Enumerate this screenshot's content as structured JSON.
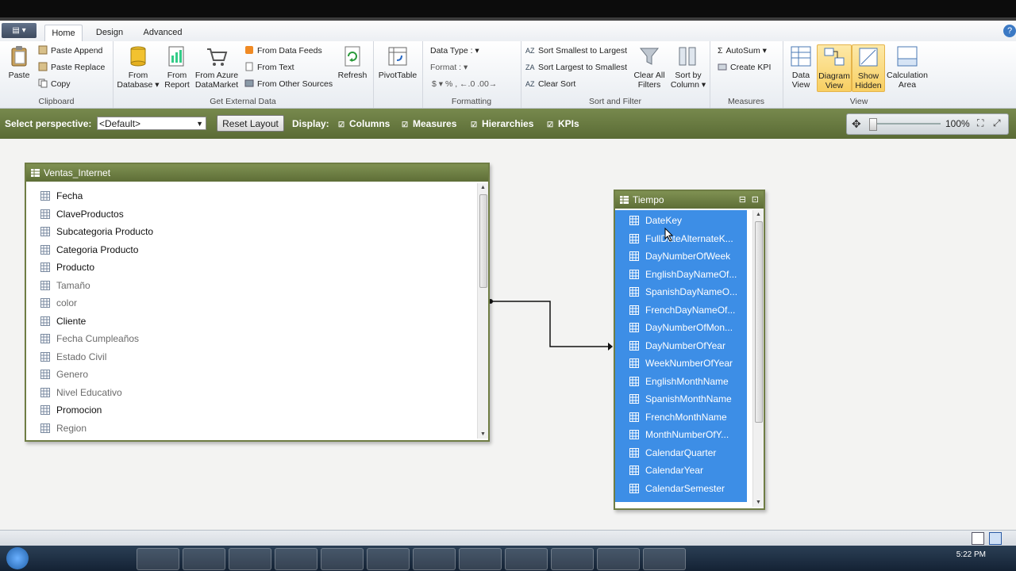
{
  "tabs": {
    "file": "▤ ▾",
    "home": "Home",
    "design": "Design",
    "advanced": "Advanced",
    "help": "?"
  },
  "ribbon": {
    "clipboard": {
      "label": "Clipboard",
      "paste": "Paste",
      "paste_append": "Paste Append",
      "paste_replace": "Paste Replace",
      "copy": "Copy"
    },
    "external": {
      "label": "Get External Data",
      "from_database": "From Database ▾",
      "from_report": "From Report",
      "from_azure": "From Azure DataMarket",
      "from_data_feeds": "From Data Feeds",
      "from_text": "From Text",
      "from_other": "From Other Sources",
      "refresh": "Refresh"
    },
    "pivot": {
      "label": "PivotTable"
    },
    "formatting": {
      "label": "Formatting",
      "data_type": "Data Type :",
      "format": "Format :",
      "symbols": "$ ▾ %  ,  ←.0 .00→"
    },
    "sort": {
      "label": "Sort and Filter",
      "asc": "Sort Smallest to Largest",
      "desc": "Sort Largest to Smallest",
      "clear": "Clear Sort",
      "clear_filters": "Clear All Filters",
      "sort_by_column": "Sort by Column ▾"
    },
    "measures": {
      "label": "Measures",
      "autosum": "AutoSum ▾",
      "create_kpi": "Create KPI"
    },
    "view": {
      "label": "View",
      "data_view": "Data View",
      "diagram_view": "Diagram View",
      "show_hidden": "Show Hidden",
      "calc_area": "Calculation Area"
    }
  },
  "perspective": {
    "label": "Select perspective:",
    "value": "<Default>",
    "reset_layout": "Reset Layout",
    "display": "Display:",
    "columns": "Columns",
    "measures": "Measures",
    "hierarchies": "Hierarchies",
    "kpis": "KPIs",
    "zoom": "100%"
  },
  "ventas": {
    "title": "Ventas_Internet",
    "columns": [
      {
        "name": "Fecha"
      },
      {
        "name": "ClaveProductos"
      },
      {
        "name": "Subcategoria Producto"
      },
      {
        "name": "Categoria Producto"
      },
      {
        "name": "Producto"
      },
      {
        "name": "Tamaño"
      },
      {
        "name": "color"
      },
      {
        "name": "Cliente"
      },
      {
        "name": "Fecha Cumpleaños"
      },
      {
        "name": "Estado Civil"
      },
      {
        "name": "Genero"
      },
      {
        "name": "Nivel Educativo"
      },
      {
        "name": "Promocion"
      },
      {
        "name": "Region"
      }
    ]
  },
  "tiempo": {
    "title": "Tiempo",
    "columns": [
      {
        "name": "DateKey"
      },
      {
        "name": "FullDateAlternateK..."
      },
      {
        "name": "DayNumberOfWeek"
      },
      {
        "name": "EnglishDayNameOf..."
      },
      {
        "name": "SpanishDayNameO..."
      },
      {
        "name": "FrenchDayNameOf..."
      },
      {
        "name": "DayNumberOfMon..."
      },
      {
        "name": "DayNumberOfYear"
      },
      {
        "name": "WeekNumberOfYear"
      },
      {
        "name": "EnglishMonthName"
      },
      {
        "name": "SpanishMonthName"
      },
      {
        "name": "FrenchMonthName"
      },
      {
        "name": "MonthNumberOfY..."
      },
      {
        "name": "CalendarQuarter"
      },
      {
        "name": "CalendarYear"
      },
      {
        "name": "CalendarSemester"
      }
    ]
  },
  "taskbar": {
    "clock": "5:22 PM"
  },
  "colors": {
    "accent": "#6f7d45",
    "selection": "#3d8ee6",
    "ribbon_active": "#f8cf62"
  }
}
